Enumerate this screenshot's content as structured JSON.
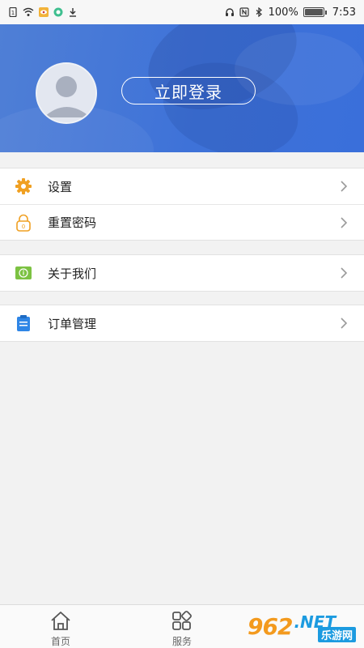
{
  "status_bar": {
    "battery": "100%",
    "time": "7:53"
  },
  "header": {
    "login_label": "立即登录"
  },
  "menu": {
    "group1": [
      {
        "label": "设置",
        "icon": "gear-icon"
      },
      {
        "label": "重置密码",
        "icon": "lock-icon"
      }
    ],
    "group2": [
      {
        "label": "关于我们",
        "icon": "info-icon"
      }
    ],
    "group3": [
      {
        "label": "订单管理",
        "icon": "clipboard-icon"
      }
    ]
  },
  "tabbar": {
    "tabs": [
      {
        "label": "首页",
        "icon": "home-icon"
      },
      {
        "label": "服务",
        "icon": "grid-icon"
      }
    ]
  },
  "watermark": {
    "num": "962",
    "net": ".NET",
    "sub": "乐游网"
  },
  "colors": {
    "header_blue": "#3e72d8",
    "gear_orange": "#f0a022",
    "info_green": "#7cc242",
    "clipboard_blue": "#2f86e6"
  }
}
